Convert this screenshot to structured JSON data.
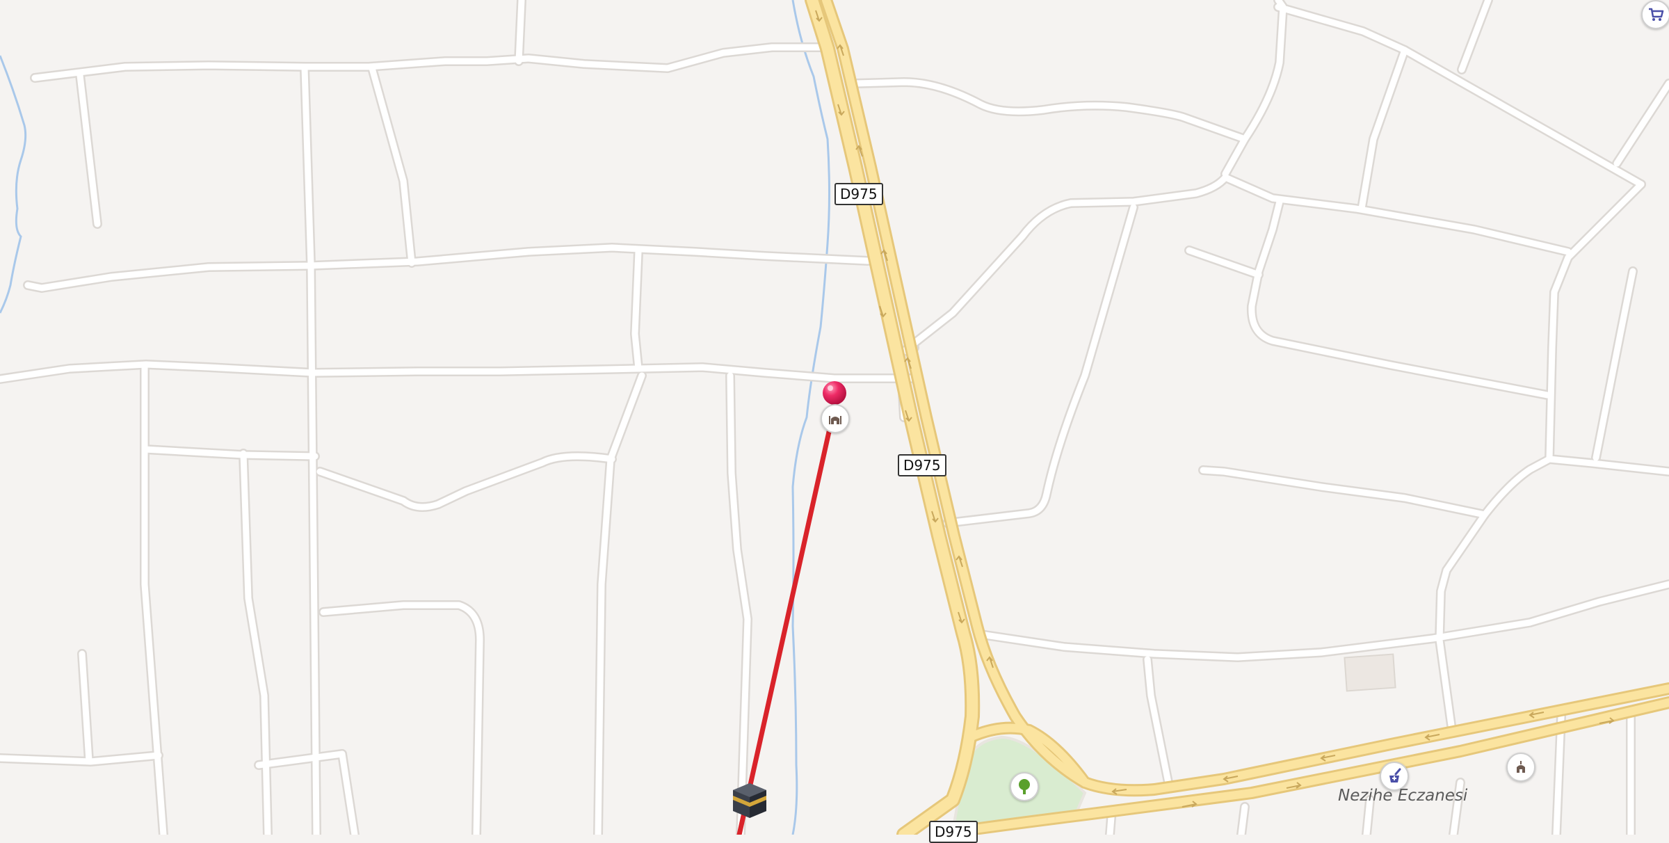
{
  "map": {
    "road_shields": [
      "D975",
      "D975",
      "D975"
    ],
    "pois": {
      "pharmacy_name": "Nezihe Eczanesi",
      "icons": [
        "mosque-icon",
        "mosque-icon",
        "pharmacy-icon",
        "park-tree-icon",
        "shopping-cart-icon",
        "kaaba-icon",
        "location-pin-icon"
      ]
    },
    "colors": {
      "background": "#f5f3f1",
      "minor_road": "#ffffff",
      "main_road": "#fbe4a0",
      "main_road_edge": "#e6c77a",
      "water": "#a9c8ea",
      "park": "#d9ecd0",
      "qibla_line": "#d9232a",
      "pin": "#e8245e",
      "poi_accent": "#4a4fa8"
    }
  }
}
